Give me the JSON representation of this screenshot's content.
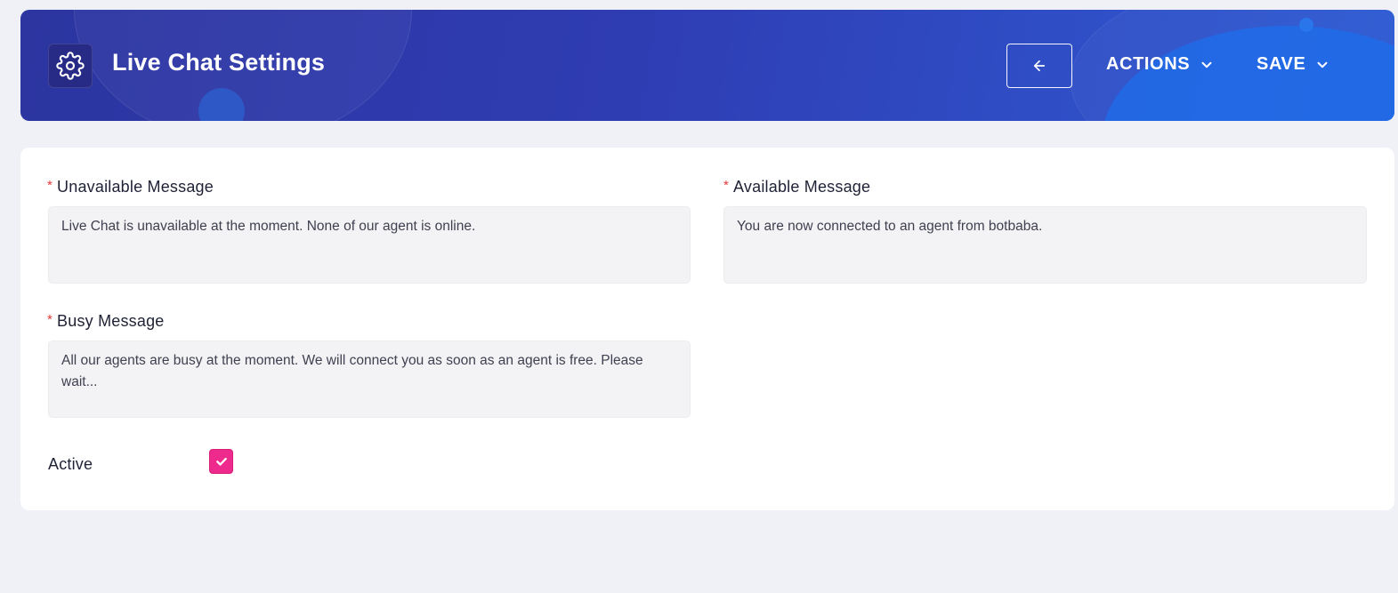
{
  "header": {
    "title": "Live Chat Settings",
    "settings_icon": "gear-icon",
    "back_icon": "arrow-left-icon",
    "actions_label": "ACTIONS",
    "save_label": "SAVE",
    "chevron_icon": "chevron-down-icon"
  },
  "form": {
    "unavailable_message": {
      "label": "Unavailable Message",
      "required_marker": "*",
      "value": "Live Chat is unavailable at the moment. None of our agent is online."
    },
    "available_message": {
      "label": "Available Message",
      "required_marker": "*",
      "value": "You are now connected to an agent from botbaba."
    },
    "busy_message": {
      "label": "Busy Message",
      "required_marker": "*",
      "value": "All our agents are busy at the moment. We will connect you as soon as an agent is free. Please wait..."
    },
    "active": {
      "label": "Active",
      "checked": true,
      "icon": "check-icon"
    }
  },
  "colors": {
    "header_start": "#2c35a0",
    "header_end": "#2d5ad3",
    "checkbox": "#ee2a8d",
    "required": "#e53935",
    "page_bg": "#f0f1f6"
  }
}
